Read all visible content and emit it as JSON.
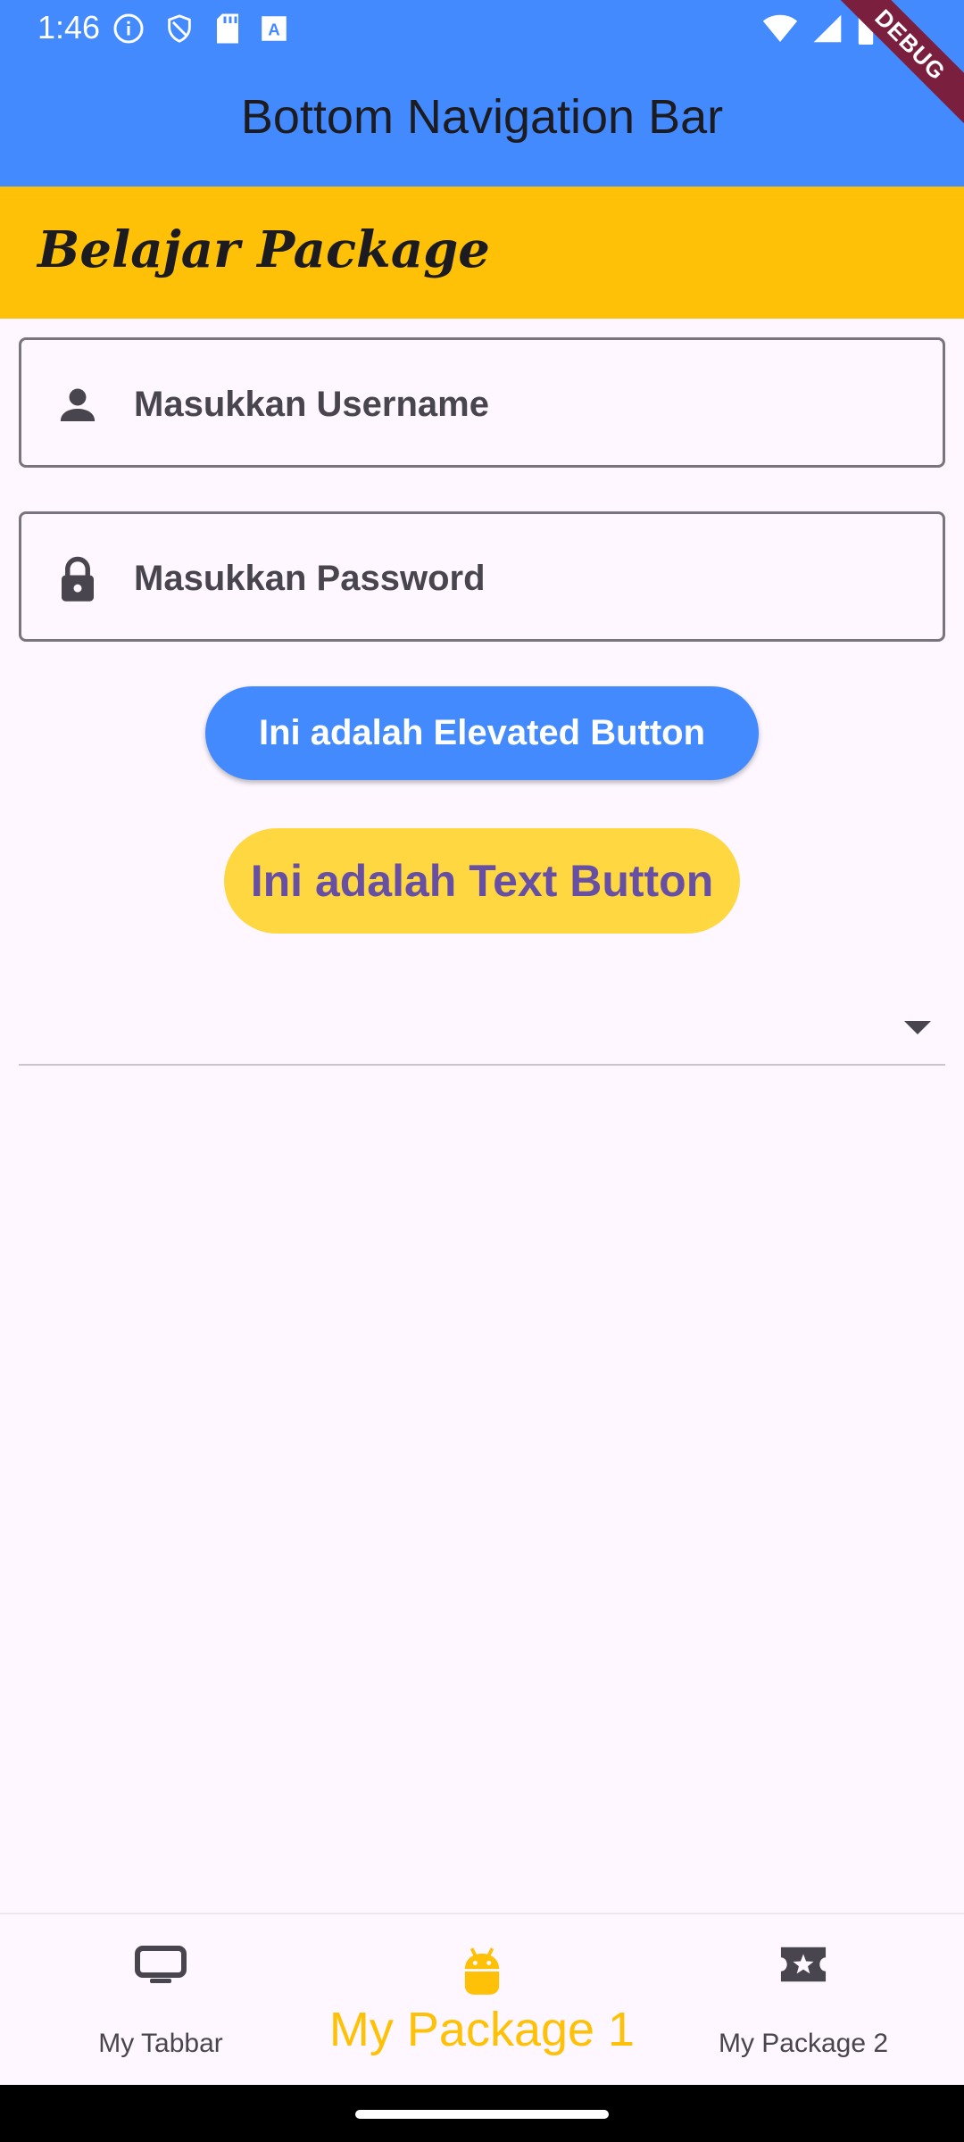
{
  "status_bar": {
    "time": "1:46",
    "left_icons": [
      "info-icon",
      "shield-icon",
      "sd-card-icon",
      "font-a-icon"
    ],
    "right_icons": [
      "wifi-icon",
      "signal-icon",
      "battery-icon"
    ]
  },
  "app_bar": {
    "title": "Bottom Navigation Bar",
    "color": "#448AFF"
  },
  "debug_banner": {
    "label": "DEBUG"
  },
  "header": {
    "title": "Belajar Package",
    "color": "#FFC107"
  },
  "form": {
    "username_placeholder": "Masukkan Username",
    "password_placeholder": "Masukkan Password",
    "username_icon": "person-icon",
    "password_icon": "lock-icon"
  },
  "buttons": {
    "elevated_label": "Ini adalah Elevated Button",
    "text_label": "Ini adalah Text Button"
  },
  "dropdown": {
    "selected_value": ""
  },
  "bottom_nav": {
    "items": [
      {
        "label": "My Tabbar",
        "icon": "tv-icon",
        "active": false
      },
      {
        "label": "My Package 1",
        "icon": "android-icon",
        "active": true
      },
      {
        "label": "My Package 2",
        "icon": "ticket-star-icon",
        "active": false
      }
    ],
    "active_color": "#FFC107"
  }
}
